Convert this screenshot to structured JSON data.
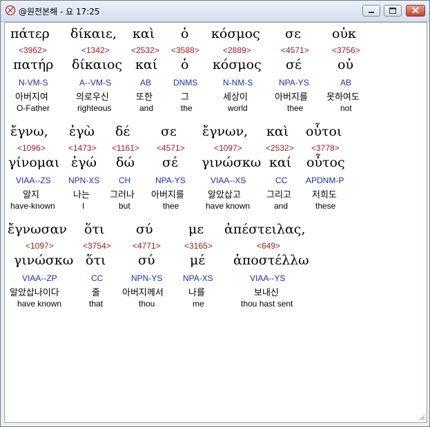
{
  "window": {
    "title": "@원전본해 - 요 17:25"
  },
  "rows": [
    {
      "words": [
        {
          "greek": "πάτερ",
          "strong": "<3962>",
          "lemma": "πατήρ",
          "parse": "N-VM-S",
          "korean": "아버지여",
          "english": "O-Father"
        },
        {
          "greek": "δίκαιε,",
          "strong": "<1342>",
          "lemma": "δίκαιος",
          "parse": "A--VM-S",
          "korean": "의로우신",
          "english": "righteous"
        },
        {
          "greek": "καὶ",
          "strong": "<2532>",
          "lemma": "καί",
          "parse": "AB",
          "korean": "또한",
          "english": "and"
        },
        {
          "greek": "ὁ",
          "strong": "<3588>",
          "lemma": "ὁ",
          "parse": "DNMS",
          "korean": "그",
          "english": "the"
        },
        {
          "greek": "κόσμος",
          "strong": "<2889>",
          "lemma": "κόσμος",
          "parse": "N-NM-S",
          "korean": "세상이",
          "english": "world"
        },
        {
          "greek": "σε",
          "strong": "<4571>",
          "lemma": "σέ",
          "parse": "NPA-YS",
          "korean": "아버지를",
          "english": "thee"
        },
        {
          "greek": "οὐκ",
          "strong": "<3756>",
          "lemma": "οὐ",
          "parse": "AB",
          "korean": "못하여도",
          "english": "not"
        }
      ]
    },
    {
      "words": [
        {
          "greek": "ἔγνω,",
          "strong": "<1096>",
          "lemma": "γίνομαι",
          "parse": "VIAA--ZS",
          "korean": "알지",
          "english": "have-known"
        },
        {
          "greek": "ἐγὼ",
          "strong": "<1473>",
          "lemma": "ἐγώ",
          "parse": "NPN-XS",
          "korean": "나는",
          "english": "I"
        },
        {
          "greek": "δέ",
          "strong": "<1161>",
          "lemma": "δώ",
          "parse": "CH",
          "korean": "그러나",
          "english": "but"
        },
        {
          "greek": "σε",
          "strong": "<4571>",
          "lemma": "σέ",
          "parse": "NPA-YS",
          "korean": "아버지를",
          "english": "thee"
        },
        {
          "greek": "ἔγνων,",
          "strong": "<1097>",
          "lemma": "γινώσκω",
          "parse": "VIAA--XS",
          "korean": "알았삽고",
          "english": "have known"
        },
        {
          "greek": "καὶ",
          "strong": "<2532>",
          "lemma": "καί",
          "parse": "CC",
          "korean": "그리고",
          "english": "and"
        },
        {
          "greek": "οὗτοι",
          "strong": "<3778>",
          "lemma": "οὗτος",
          "parse": "APDNM-P",
          "korean": "저희도",
          "english": "these"
        }
      ]
    },
    {
      "words": [
        {
          "greek": "ἔγνωσαν",
          "strong": "<1097>",
          "lemma": "γινώσκω",
          "parse": "VIAA--ZP",
          "korean": "알았삽나이다",
          "english": "have known"
        },
        {
          "greek": "ὅτι",
          "strong": "<3754>",
          "lemma": "ὅτι",
          "parse": "CC",
          "korean": "줄",
          "english": "that"
        },
        {
          "greek": "σύ",
          "strong": "<4771>",
          "lemma": "σύ",
          "parse": "NPN-YS",
          "korean": "아버지께서",
          "english": "thou"
        },
        {
          "greek": "με",
          "strong": "<3165>",
          "lemma": "μέ",
          "parse": "NPA-XS",
          "korean": "나를",
          "english": "me"
        },
        {
          "greek": "ἀπέστειλας,",
          "strong": "<649>",
          "lemma": "ἀποστέλλω",
          "parse": "VIAA--YS",
          "korean": "보내신",
          "english": "thou hast sent"
        }
      ]
    }
  ]
}
